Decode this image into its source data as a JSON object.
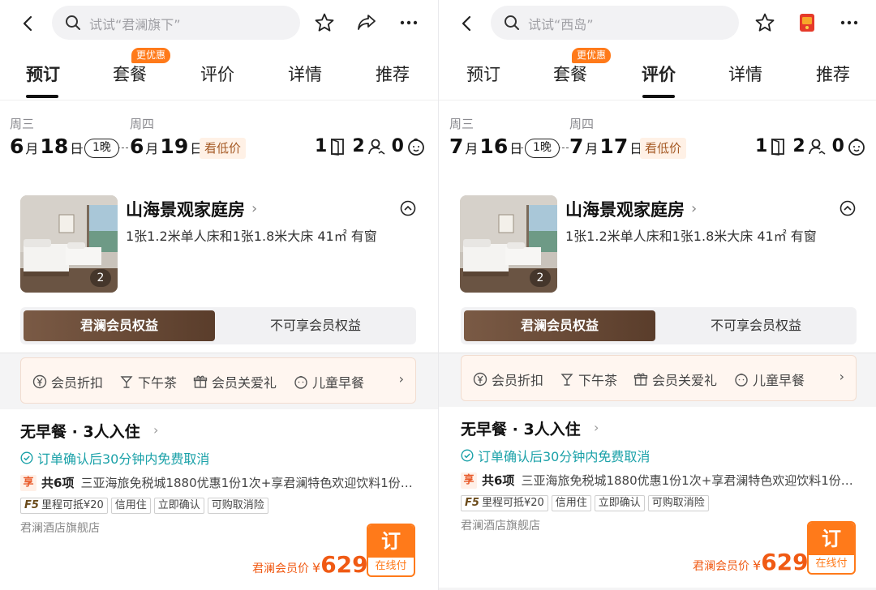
{
  "panels": [
    {
      "search_placeholder": "试试“君澜旗下”",
      "tabs": [
        "预订",
        "套餐",
        "评价",
        "详情",
        "推荐"
      ],
      "active_tab": 0,
      "tab_badge": "更优惠",
      "checkin": {
        "weekday": "周三",
        "month": "6",
        "day": "18"
      },
      "checkout": {
        "weekday": "周四",
        "month": "6",
        "day": "19"
      },
      "month_unit": "月",
      "day_unit": "日",
      "nights": "1晚",
      "low_price": "看低价",
      "rooms": "1",
      "adults": "2",
      "children": "0",
      "room": {
        "title": "山海景观家庭房",
        "desc": "1张1.2米单人床和1张1.8米大床 41㎡ 有窗",
        "photo_count": "2"
      },
      "segment": {
        "on": "君澜会员权益",
        "off": "不可享会员权益"
      },
      "benefits": [
        "会员折扣",
        "下午茶",
        "会员关爱礼",
        "儿童早餐"
      ],
      "offer": {
        "title": "无早餐 · 3人入住",
        "cancel": "订单确认后30分钟内免费取消",
        "perk_badge": "享",
        "perk_count": "共6项",
        "perk_text": "三亚海旅免税城1880优惠1份1次+享君澜特色欢迎饮料1份…",
        "tags": [
          "里程可抵¥20",
          "信用住",
          "立即确认",
          "可购取消险"
        ],
        "mileage_prefix": "F5",
        "shop": "君澜酒店旗舰店",
        "price_label": "君澜会员价",
        "currency": "¥",
        "price": "629",
        "book": "订",
        "pay": "在线付"
      }
    },
    {
      "search_placeholder": "试试“西岛”",
      "tabs": [
        "预订",
        "套餐",
        "评价",
        "详情",
        "推荐"
      ],
      "active_tab": 2,
      "tab_badge": "更优惠",
      "checkin": {
        "weekday": "周三",
        "month": "7",
        "day": "16"
      },
      "checkout": {
        "weekday": "周四",
        "month": "7",
        "day": "17"
      },
      "month_unit": "月",
      "day_unit": "日",
      "nights": "1晚",
      "low_price": "看低价",
      "rooms": "1",
      "adults": "2",
      "children": "0",
      "room": {
        "title": "山海景观家庭房",
        "desc": "1张1.2米单人床和1张1.8米大床 41㎡ 有窗",
        "photo_count": "2"
      },
      "segment": {
        "on": "君澜会员权益",
        "off": "不可享会员权益"
      },
      "benefits": [
        "会员折扣",
        "下午茶",
        "会员关爱礼",
        "儿童早餐"
      ],
      "offer": {
        "title": "无早餐 · 3人入住",
        "cancel": "订单确认后30分钟内免费取消",
        "perk_badge": "享",
        "perk_count": "共6项",
        "perk_text": "三亚海旅免税城1880优惠1份1次+享君澜特色欢迎饮料1份…",
        "tags": [
          "里程可抵¥20",
          "信用住",
          "立即确认",
          "可购取消险"
        ],
        "mileage_prefix": "F5",
        "shop": "君澜酒店旗舰店",
        "price_label": "君澜会员价",
        "currency": "¥",
        "price": "629",
        "book": "订",
        "pay": "在线付"
      }
    }
  ],
  "icons": {
    "back": "chevron-left-icon",
    "search": "search-icon",
    "favorite": "star-icon",
    "share": "share-icon",
    "miniapp": "red-app-icon",
    "more": "more-icon"
  },
  "colors": {
    "accent_orange": "#ff7a1a",
    "member_brown": "#6a4a36",
    "cancel_teal": "#1aa1a8",
    "price_orange": "#f05a14"
  }
}
